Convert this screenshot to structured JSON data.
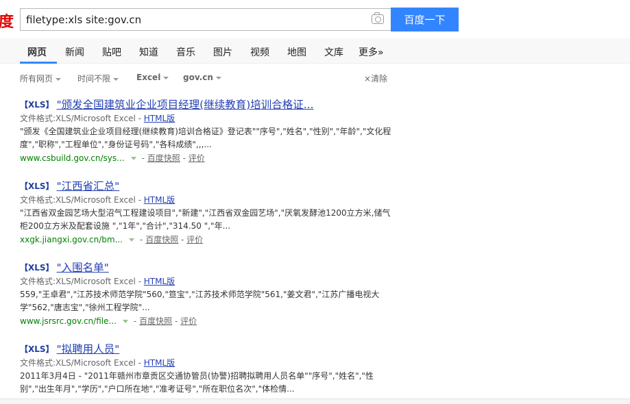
{
  "logo_text": "度",
  "search": {
    "query": "filetype:xls site:gov.cn",
    "button": "百度一下"
  },
  "nav": [
    "网页",
    "新闻",
    "贴吧",
    "知道",
    "音乐",
    "图片",
    "视频",
    "地图",
    "文库",
    "更多»"
  ],
  "filters": {
    "all": "所有网页",
    "time": "时间不限",
    "type": "Excel",
    "site": "gov.cn",
    "clear": "清除"
  },
  "results": [
    {
      "tag": "【XLS】",
      "title": "\"颁发全国建筑业企业项目经理(继续教育)培训合格证...",
      "format_label": "文件格式:XLS/Microsoft Excel - ",
      "html_link": "HTML版",
      "abstract": "\"颁发《全国建筑业企业项目经理(继续教育)培训合格证》登记表\"\"序号\",\"姓名\",\"性别\",\"年龄\",\"文化程度\",\"职称\",\"工程单位\",\"身份证号码\",\"各科成绩\",,,...",
      "url": "www.csbuild.gov.cn/sys...",
      "snapshot": "百度快照",
      "review": "评价"
    },
    {
      "tag": "【XLS】",
      "title": "\"江西省汇总\"",
      "format_label": "文件格式:XLS/Microsoft Excel - ",
      "html_link": "HTML版",
      "abstract": "\"江西省双金园艺场大型沼气工程建设项目\",\"新建\",\"江西省双金园艺场\",\"厌氧发酵池1200立方米,储气柜200立方米及配套设施 \",\"1年\",\"合计\",\"314.50 \",\"年...",
      "url": "xxgk.jiangxi.gov.cn/bm...",
      "snapshot": "百度快照",
      "review": "评价"
    },
    {
      "tag": "【XLS】",
      "title": "\"入围名单\"",
      "format_label": "文件格式:XLS/Microsoft Excel - ",
      "html_link": "HTML版",
      "abstract": "559,\"王卓君\",\"江苏技术师范学院\"560,\"笪宝\",\"江苏技术师范学院\"561,\"姜文君\",\"江苏广播电视大学\"562,\"唐志宝\",\"徐州工程学院\"...",
      "url": "www.jsrsrc.gov.cn/file...",
      "snapshot": "百度快照",
      "review": "评价"
    },
    {
      "tag": "【XLS】",
      "title": "\"拟聘用人员\"",
      "format_label": "文件格式:XLS/Microsoft Excel - ",
      "html_link": "HTML版",
      "abstract": "2011年3月4日 - \"2011年赣州市章贡区交通协管员(协警)招聘拟聘用人员名单\"\"序号\",\"姓名\",\"性别\",\"出生年月\",\"学历\",\"户口所在地\",\"准考证号\",\"所在职位名次\",\"体检情...",
      "url": "",
      "snapshot": "",
      "review": ""
    }
  ],
  "colors": {
    "accent": "#3385ff",
    "link": "#2440b3",
    "url_green": "#008000",
    "logo_red": "#e10602"
  }
}
